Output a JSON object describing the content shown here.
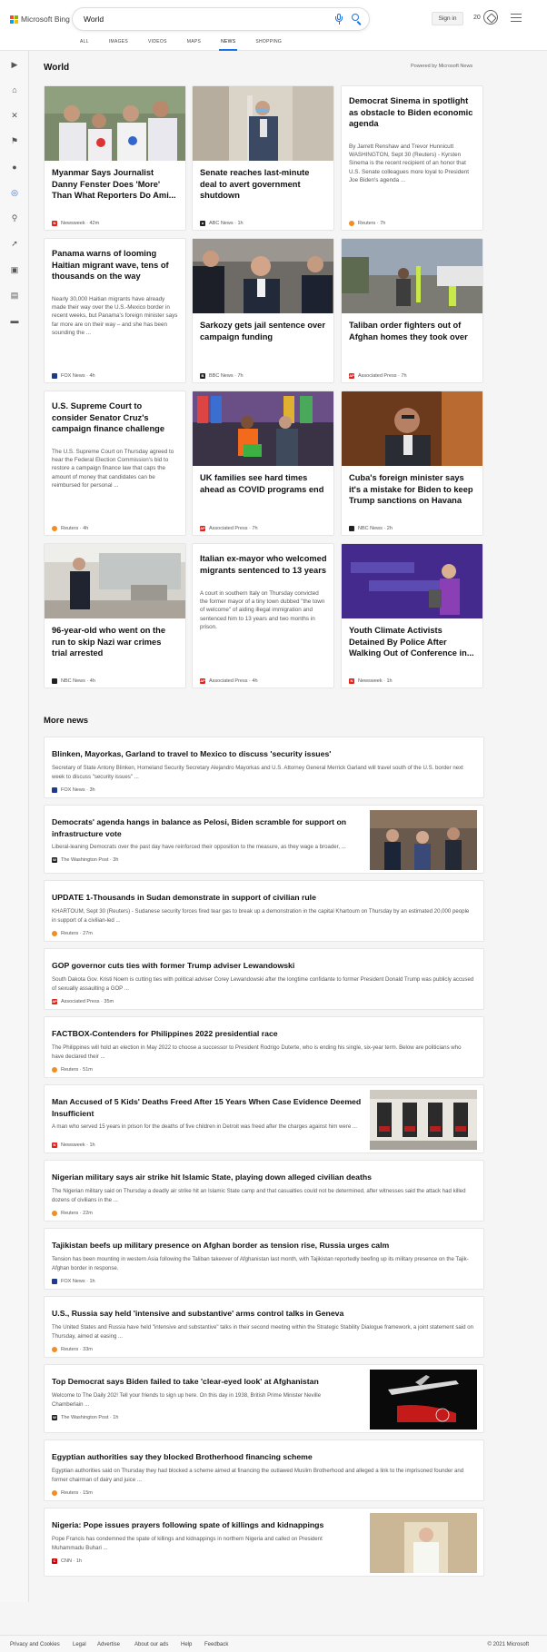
{
  "brand": {
    "name": "Microsoft Bing"
  },
  "search": {
    "query": "World"
  },
  "header": {
    "signin_label": "Sign in",
    "rewards_count": "20"
  },
  "tabs": [
    "ALL",
    "IMAGES",
    "VIDEOS",
    "MAPS",
    "NEWS",
    "SHOPPING"
  ],
  "active_tab": "NEWS",
  "rail": {
    "icons": [
      "chevron-right-icon",
      "home-icon",
      "crossed-tools-icon",
      "flag-icon",
      "location-pin-icon",
      "globe-icon",
      "microscope-icon",
      "rocket-icon",
      "film-icon",
      "bank-icon",
      "card-icon"
    ]
  },
  "section": {
    "title": "World",
    "powered": "Powered by Microsoft News"
  },
  "cards": [
    {
      "title": "Myanmar Says Journalist Danny Fenster Does 'More' Than What Reporters Do Ami...",
      "source": "Newsweek",
      "age": "42m",
      "src_color": "#e2231a",
      "desc": ""
    },
    {
      "title": "Senate reaches last-minute deal to avert government shutdown",
      "source": "ABC News",
      "age": "1h",
      "src_color": "#222222",
      "desc": ""
    },
    {
      "title": "Democrat Sinema in spotlight as obstacle to Biden economic agenda",
      "source": "Reuters",
      "age": "7h",
      "src_color": "#f28c28",
      "desc": "By Jarrett Renshaw and Trevor Hunnicutt WASHINGTON, Sept 30 (Reuters) - Kyrsten Sinema is the recent recipient of an honor that U.S. Senate colleagues more loyal to President Joe Biden's agenda ..."
    },
    {
      "title": "Panama warns of looming Haitian migrant wave, tens of thousands on the way",
      "source": "FOX News",
      "age": "4h",
      "src_color": "#1e3a8a",
      "desc": "Nearly 30,000 Haitian migrants have already made their way over the U.S.-Mexico border in recent weeks, but Panama's foreign minister says far more are on their way – and she has been sounding the ..."
    },
    {
      "title": "Sarkozy gets jail sentence over campaign funding",
      "source": "BBC News",
      "age": "7h",
      "src_color": "#222222",
      "desc": ""
    },
    {
      "title": "Taliban order fighters out of Afghan homes they took over",
      "source": "Associated Press",
      "age": "7h",
      "src_color": "#e2231a",
      "desc": ""
    },
    {
      "title": "U.S. Supreme Court to consider Senator Cruz's campaign finance challenge",
      "source": "Reuters",
      "age": "4h",
      "src_color": "#f28c28",
      "desc": "The U.S. Supreme Court on Thursday agreed to hear the Federal Election Commission's bid to restore a campaign finance law that caps the amount of money that candidates can be reimbursed for personal ..."
    },
    {
      "title": "UK families see hard times ahead as COVID programs end",
      "source": "Associated Press",
      "age": "7h",
      "src_color": "#e2231a",
      "desc": ""
    },
    {
      "title": "Cuba's foreign minister says it's a mistake for Biden to keep Trump sanctions on Havana",
      "source": "NBC News",
      "age": "2h",
      "src_color": "#222222",
      "desc": ""
    },
    {
      "title": "96-year-old who went on the run to skip Nazi war crimes trial arrested",
      "source": "NBC News",
      "age": "4h",
      "src_color": "#222222",
      "desc": ""
    },
    {
      "title": "Italian ex-mayor who welcomed migrants sentenced to 13 years",
      "source": "Associated Press",
      "age": "4h",
      "src_color": "#e2231a",
      "desc": "A court in southern Italy on Thursday convicted the former mayor of a tiny town dubbed \"the town of welcome\" of aiding illegal immigration and sentenced him to 13 years and two months in prison."
    },
    {
      "title": "Youth Climate Activists Detained By Police After Walking Out of Conference in...",
      "source": "Newsweek",
      "age": "1h",
      "src_color": "#e2231a",
      "desc": ""
    }
  ],
  "more_news": {
    "title": "More news",
    "items": [
      {
        "title": "Blinken, Mayorkas, Garland to travel to Mexico to discuss 'security issues'",
        "desc": "Secretary of State Antony Blinken, Homeland Security Secretary Alejandro Mayorkas and U.S. Attorney General Merrick Garland will travel south of the U.S. border next week to discuss \"security issues\" ...",
        "source": "FOX News",
        "age": "3h",
        "src_color": "#1e3a8a"
      },
      {
        "title": "Democrats' agenda hangs in balance as Pelosi, Biden scramble for support on infrastructure vote",
        "desc": "Liberal-leaning Democrats over the past day have reinforced their opposition to the measure, as they wage a broader, ...",
        "source": "The Washington Post",
        "age": "3h",
        "src_color": "#222222"
      },
      {
        "title": "UPDATE 1-Thousands in Sudan demonstrate in support of civilian rule",
        "desc": "KHARTOUM, Sept 30 (Reuters) - Sudanese security forces fired tear gas to break up a demonstration in the capital Khartoum on Thursday by an estimated 20,000 people in support of a civilian-led ...",
        "source": "Reuters",
        "age": "27m",
        "src_color": "#f28c28"
      },
      {
        "title": "GOP governor cuts ties with former Trump adviser Lewandowski",
        "desc": "South Dakota Gov. Kristi Noem is cutting ties with political adviser Corey Lewandowski after the longtime confidante to former President Donald Trump was publicly accused of sexually assaulting a GOP ...",
        "source": "Associated Press",
        "age": "35m",
        "src_color": "#e2231a"
      },
      {
        "title": "FACTBOX-Contenders for Philippines 2022 presidential race",
        "desc": "The Philippines will hold an election in May 2022 to choose a successor to President Rodrigo Duterte, who is ending his single, six-year term. Below are politicians who have declared their ...",
        "source": "Reuters",
        "age": "51m",
        "src_color": "#f28c28"
      },
      {
        "title": "Man Accused of 5 Kids' Deaths Freed After 15 Years When Case Evidence Deemed Insufficient",
        "desc": "A man who served 15 years in prison for the deaths of five children in Detroit was freed after the charges against him were ...",
        "source": "Newsweek",
        "age": "1h",
        "src_color": "#e2231a"
      },
      {
        "title": "Nigerian military says air strike hit Islamic State, playing down alleged civilian deaths",
        "desc": "The Nigerian military said on Thursday a deadly air strike hit an Islamic State camp and that casualties could not be determined, after witnesses said the attack had killed dozens of civilians in the ...",
        "source": "Reuters",
        "age": "22m",
        "src_color": "#f28c28"
      },
      {
        "title": "Tajikistan beefs up military presence on Afghan border as tension rise, Russia urges calm",
        "desc": "Tension has been mounting in western Asia following the Taliban takeover of Afghanistan last month, with Tajikistan reportedly beefing up its military presence on the Tajik-Afghan border in response.",
        "source": "FOX News",
        "age": "1h",
        "src_color": "#1e3a8a"
      },
      {
        "title": "U.S., Russia say held 'intensive and substantive' arms control talks in Geneva",
        "desc": "The United States and Russia have held \"intensive and substantive\" talks in their second meeting within the Strategic Stability Dialogue framework, a joint statement said on Thursday, aimed at easing ...",
        "source": "Reuters",
        "age": "33m",
        "src_color": "#f28c28"
      },
      {
        "title": "Top Democrat says Biden failed to take 'clear-eyed look' at Afghanistan",
        "desc": "Welcome to The Daily 202! Tell your friends to sign up here. On this day in 1938, British Prime Minister Neville Chamberlain ...",
        "source": "The Washington Post",
        "age": "1h",
        "src_color": "#222222"
      },
      {
        "title": "Egyptian authorities say they blocked Brotherhood financing scheme",
        "desc": "Egyptian authorities said on Thursday they had blocked a scheme aimed at financing the outlawed Muslim Brotherhood and alleged a link to the imprisoned founder and former chairman of dairy and juice ...",
        "source": "Reuters",
        "age": "15m",
        "src_color": "#f28c28"
      },
      {
        "title": "Nigeria: Pope issues prayers following spate of killings and kidnappings",
        "desc": "Pope Francis has condemned the spate of killings and kidnappings in northern Nigeria and called on President Muhammadu Buhari ...",
        "source": "CNN",
        "age": "1h",
        "src_color": "#cc0000"
      }
    ]
  },
  "footer": {
    "links": [
      "Privacy and Cookies",
      "Legal",
      "Advertise",
      "About our ads",
      "Help",
      "Feedback"
    ],
    "copyright": "© 2021 Microsoft"
  }
}
